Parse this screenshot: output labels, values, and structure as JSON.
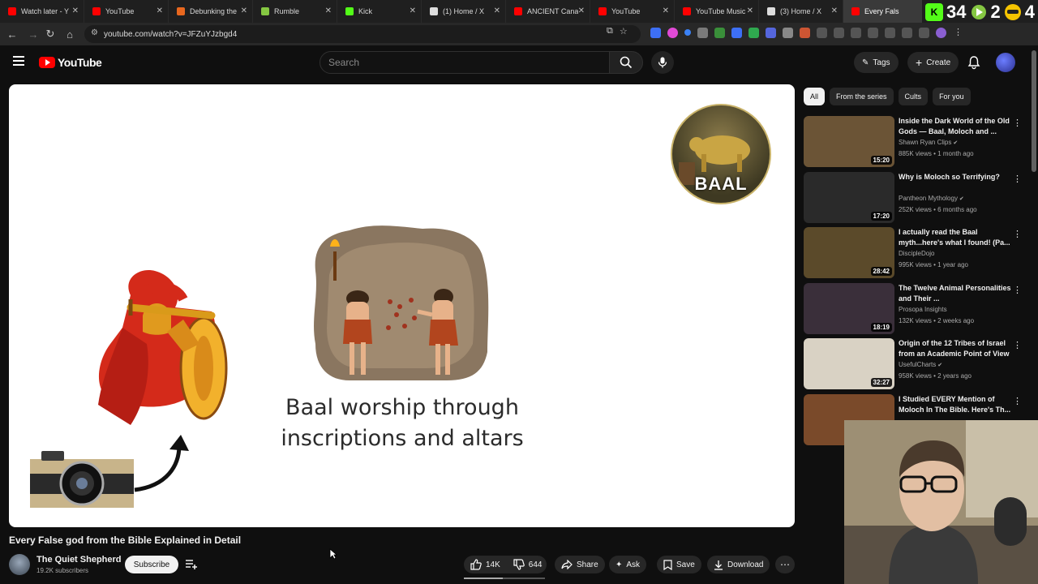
{
  "browser": {
    "tabs": [
      {
        "label": "Watch later - Y",
        "color": "#ff0000"
      },
      {
        "label": "YouTube",
        "color": "#ff0000"
      },
      {
        "label": "Debunking the",
        "color": "#e8671e"
      },
      {
        "label": "Rumble",
        "color": "#85c742"
      },
      {
        "label": "Kick",
        "color": "#53fc18"
      },
      {
        "label": "(1) Home / X",
        "color": "#dddddd"
      },
      {
        "label": "ANCIENT Cana",
        "color": "#ff0000"
      },
      {
        "label": "YouTube",
        "color": "#ff0000"
      },
      {
        "label": "YouTube Music",
        "color": "#ff0000"
      },
      {
        "label": "(3) Home / X",
        "color": "#dddddd"
      },
      {
        "label": "Every Fals",
        "color": "#ff0000"
      }
    ],
    "url": "youtube.com/watch?v=JFZuYJzbgd4"
  },
  "scoreboard": {
    "k": "K",
    "score1": "34",
    "score2": "2",
    "score3": "4"
  },
  "header": {
    "logo_text": "YouTube",
    "search_placeholder": "Search",
    "tags_label": "Tags",
    "create_label": "Create"
  },
  "video": {
    "caption": "Baal worship through inscriptions and altars",
    "badge_text": "BAAL",
    "title": "Every False god from the Bible Explained in Detail",
    "channel": "The Quiet Shepherd",
    "subscribers": "19.2K subscribers",
    "subscribe_label": "Subscribe",
    "likes": "14K",
    "dislikes": "644",
    "like_ratio": 0.48,
    "share_label": "Share",
    "ask_label": "Ask",
    "save_label": "Save",
    "download_label": "Download"
  },
  "sidebar": {
    "chips": [
      "All",
      "From the series",
      "Cults",
      "For you"
    ],
    "recommendations": [
      {
        "title": "Inside the Dark World of the Old Gods — Baal, Moloch and ...",
        "channel": "Shawn Ryan Clips",
        "verified": true,
        "meta": "885K views • 1 month ago",
        "duration": "15:20",
        "thumb_color": "#6b5436"
      },
      {
        "title": "Why is Moloch so Terrifying?",
        "channel": "Pantheon Mythology",
        "verified": true,
        "meta": "252K views • 6 months ago",
        "duration": "17:20",
        "thumb_color": "#2a2a2a"
      },
      {
        "title": "I actually read the Baal myth...here's what I found! (Pa...",
        "channel": "DiscipleDojo",
        "verified": false,
        "meta": "995K views • 1 year ago",
        "duration": "28:42",
        "thumb_color": "#5b4a2a"
      },
      {
        "title": "The Twelve Animal Personalities and Their ...",
        "channel": "Prosopa Insights",
        "verified": false,
        "meta": "132K views • 2 weeks ago",
        "duration": "18:19",
        "thumb_color": "#3a2f3a"
      },
      {
        "title": "Origin of the 12 Tribes of Israel from an Academic Point of View",
        "channel": "UsefulCharts",
        "verified": true,
        "meta": "958K views • 2 years ago",
        "duration": "32:27",
        "thumb_color": "#d9d2c4"
      },
      {
        "title": "I Studied EVERY Mention of Moloch In The Bible. Here's Th...",
        "channel": "",
        "verified": false,
        "meta": "",
        "duration": "",
        "thumb_color": "#7a4a2a"
      }
    ]
  }
}
